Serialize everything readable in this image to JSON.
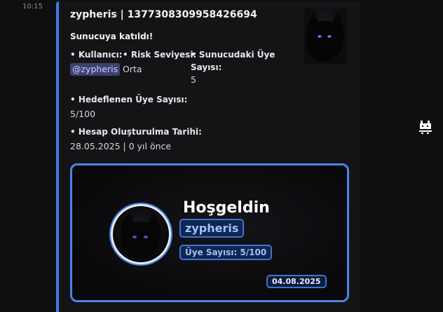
{
  "message": {
    "timestamp": "10:15"
  },
  "embed": {
    "title": "zypheris | 1377308309958426694",
    "description": "Sunucuya katıldı!",
    "accent_color": "#3f7be6",
    "fields": {
      "user": {
        "name": "• Kullanıcı:",
        "value": "@zypheris"
      },
      "risk": {
        "name": "• Risk Seviyesi:",
        "value": "Orta"
      },
      "members": {
        "name_line1": "• Sunucudaki Üye",
        "name_line2": "Sayısı:",
        "value": "5"
      },
      "target": {
        "name": "• Hedeflenen Üye Sayısı:",
        "value": "5/100"
      },
      "created": {
        "name": "• Hesap Oluşturulma Tarihi:",
        "value": "28.05.2025 | 0 yıl önce"
      }
    },
    "thumbnail_icon": "black-cat-avatar-icon"
  },
  "welcome_card": {
    "title": "Hoşgeldin",
    "username": "zypheris",
    "member_count": "Üye Sayısı: 5/100",
    "date": "04.08.2025",
    "border_color": "#4a86e8"
  },
  "side_icon": "pixel-cat-icon"
}
